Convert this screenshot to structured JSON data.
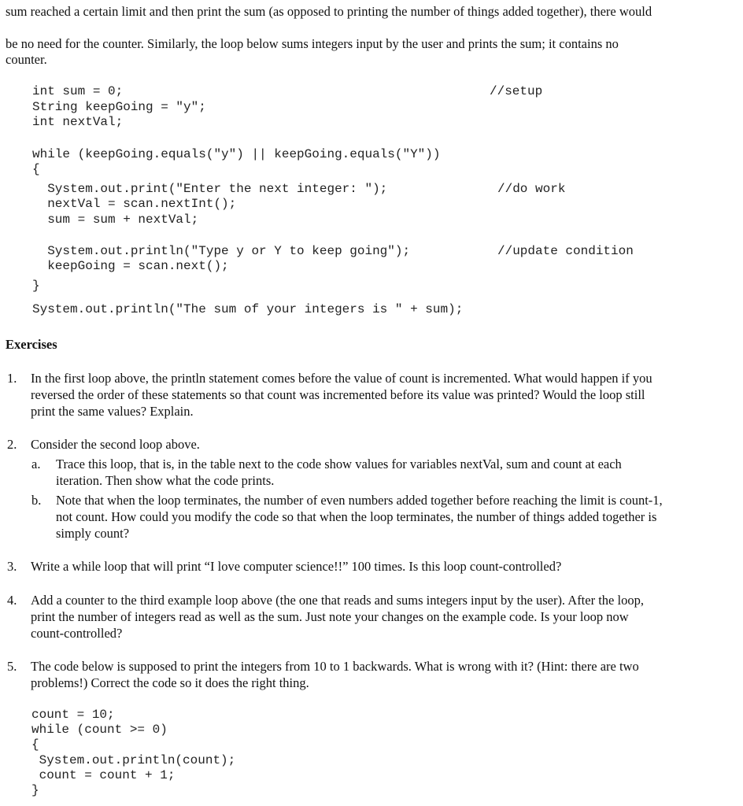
{
  "intro": {
    "line1": "sum reached a certain limit and then print the sum (as opposed to printing the number of things added together), there would",
    "line2": "be no need for the counter. Similarly, the loop below sums integers input by the user and prints the sum; it contains no",
    "line3": "counter."
  },
  "code1": {
    "lines": [
      "int sum = 0;",
      "String keepGoing = \"y\";",
      "int nextVal;",
      "while (keepGoing.equals(\"y\") || keepGoing.equals(\"Y\"))",
      "{",
      "  System.out.print(\"Enter the next integer: \");",
      "  nextVal = scan.nextInt();",
      "  sum = sum + nextVal;",
      "  System.out.println(\"Type y or Y to keep going\");",
      "  keepGoing = scan.next();",
      "}",
      "System.out.println(\"The sum of your integers is \" + sum);"
    ],
    "comments": {
      "setup": "//setup",
      "do_work": "//do work",
      "update": "//update condition"
    }
  },
  "exercises": {
    "heading": "Exercises",
    "items": [
      {
        "number": "1.",
        "lines": [
          "In the first loop above, the println statement comes before the value of count is incremented. What would happen if you",
          "reversed the order of these statements so that count was incremented before its value was printed? Would the loop still",
          "print the same values? Explain."
        ]
      },
      {
        "number": "2.",
        "lines": [
          "Consider the second loop above."
        ],
        "sub": [
          {
            "letter": "a.",
            "lines": [
              "Trace this loop, that is, in the table next to the code show values for variables nextVal, sum and count at each",
              "iteration. Then show what the code prints."
            ]
          },
          {
            "letter": "b.",
            "lines": [
              "Note that when the loop terminates, the number of even numbers added together before reaching the limit is count-1,",
              "not count. How could you modify the code so that when the loop terminates, the number of things added together is",
              "simply count?"
            ]
          }
        ]
      },
      {
        "number": "3.",
        "lines": [
          "Write a while loop that will print “I love computer science!!” 100 times. Is this loop count-controlled?"
        ]
      },
      {
        "number": "4.",
        "lines": [
          "Add a counter to the third example loop above (the one that reads and sums integers input by the user). After the loop,",
          "print the number of integers read as well as the sum. Just note your changes on the example code. Is your loop now",
          "count-controlled?"
        ]
      },
      {
        "number": "5.",
        "lines": [
          "The code below is supposed to print the integers from 10 to 1 backwards. What is wrong with it? (Hint: there are two",
          "problems!) Correct the code so it does the right thing."
        ]
      }
    ]
  },
  "code2": {
    "lines": [
      "count = 10;",
      "while (count >= 0)",
      "{",
      " System.out.println(count);",
      " count = count + 1;",
      "}"
    ]
  }
}
